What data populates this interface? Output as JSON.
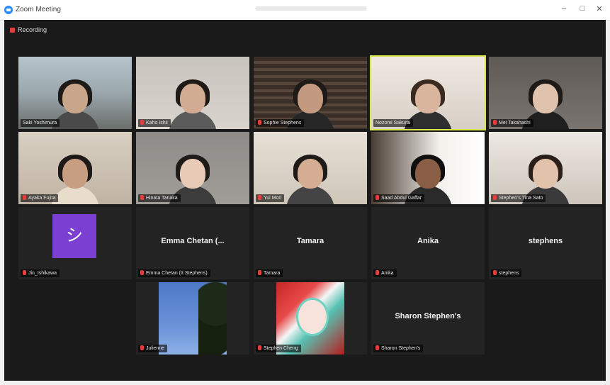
{
  "window": {
    "title": "Zoom Meeting",
    "controls": [
      "–",
      "□",
      "✕"
    ]
  },
  "meeting": {
    "recording_label": "Recording",
    "rec_color": "#e0413a",
    "active_speaker_color": "#d7e64a"
  },
  "tiles": [
    {
      "name": "Saki Yoshimura"
    },
    {
      "name": "Kaho Ishii"
    },
    {
      "name": "Sophie Stephens"
    },
    {
      "name": "Nozomi Sakurai"
    },
    {
      "name": "Mei Takahashi"
    },
    {
      "name": "Ayaka Fujita"
    },
    {
      "name": "Hinata Tanaka"
    },
    {
      "name": "Yui Mori"
    },
    {
      "name": "Saad Abdul Gaffar"
    },
    {
      "name": "Stephen's Tina Sato"
    },
    {
      "name": "Jin_Ishikawa",
      "avatar_glyph": "シ",
      "avatar_color": "#7b3fd1"
    },
    {
      "name": "Emma Chetan (It Stephens)",
      "display": "Emma Chetan (..."
    },
    {
      "name": "Tamara",
      "display": "Tamara"
    },
    {
      "name": "Anika",
      "display": "Anika"
    },
    {
      "name": "stephens",
      "display": "stephens"
    },
    {
      "name": "Julienne"
    },
    {
      "name": "Stephen Cheng"
    },
    {
      "name": "Sharon Stephen's",
      "display": "Sharon Stephen's"
    }
  ]
}
